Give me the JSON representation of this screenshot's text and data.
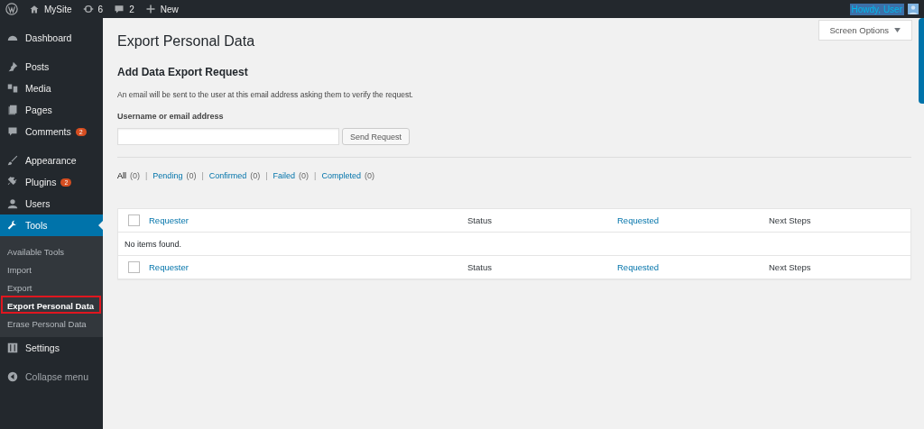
{
  "admin_bar": {
    "site": "MySite",
    "updates": "6",
    "comments": "2",
    "new": "New",
    "howdy": "Howdy, User"
  },
  "sidebar": {
    "groups": [
      [
        {
          "label": "Dashboard",
          "kind": "dashboard",
          "selected": false
        }
      ],
      [
        {
          "label": "Posts",
          "kind": "pin",
          "selected": false
        },
        {
          "label": "Media",
          "kind": "media",
          "selected": false
        },
        {
          "label": "Pages",
          "kind": "pages",
          "selected": false
        },
        {
          "label": "Comments",
          "kind": "comment",
          "selected": false,
          "badge": "2"
        }
      ],
      [
        {
          "label": "Appearance",
          "kind": "brush",
          "selected": false
        },
        {
          "label": "Plugins",
          "kind": "plug",
          "selected": false,
          "badge": "2"
        },
        {
          "label": "Users",
          "kind": "user",
          "selected": false
        },
        {
          "label": "Tools",
          "kind": "wrench",
          "selected": true,
          "children": [
            {
              "label": "Available Tools",
              "selected": false,
              "outlined": false
            },
            {
              "label": "Import",
              "selected": false,
              "outlined": false
            },
            {
              "label": "Export",
              "selected": false,
              "outlined": false
            },
            {
              "label": "Export Personal Data",
              "selected": true,
              "outlined": true
            },
            {
              "label": "Erase Personal Data",
              "selected": false,
              "outlined": false
            }
          ]
        },
        {
          "label": "Settings",
          "kind": "sliders",
          "selected": false
        }
      ]
    ],
    "collapse": "Collapse menu"
  },
  "screen_options": "Screen Options",
  "page_title": "Export Personal Data",
  "form": {
    "heading": "Add Data Export Request",
    "description": "An email will be sent to the user at this email address asking them to verify the request.",
    "field_label": "Username or email address",
    "button": "Send Request"
  },
  "filters": [
    {
      "label": "All",
      "count": "(0)",
      "selected": true
    },
    {
      "separator": "|",
      "label": "Pending",
      "count": "(0)",
      "selected": false
    },
    {
      "separator": "|",
      "label": "Confirmed",
      "count": "(0)",
      "selected": false
    },
    {
      "separator": "|",
      "label": "Failed",
      "count": "(0)",
      "selected": false
    },
    {
      "separator": "|",
      "label": "Completed",
      "count": "(0)",
      "selected": false
    }
  ],
  "table": {
    "header_checked": false,
    "footer_checked": false,
    "columns": [
      {
        "label": "Requester",
        "sortable": true
      },
      {
        "label": "Status",
        "sortable": false
      },
      {
        "label": "Requested",
        "sortable": true
      },
      {
        "label": "Next Steps",
        "sortable": false
      }
    ],
    "empty_message": "No items found.",
    "footer_columns": [
      {
        "label": "Requester",
        "sortable": true
      },
      {
        "label": "Status",
        "sortable": false
      },
      {
        "label": "Requested",
        "sortable": true
      },
      {
        "label": "Next Steps",
        "sortable": false
      }
    ]
  }
}
